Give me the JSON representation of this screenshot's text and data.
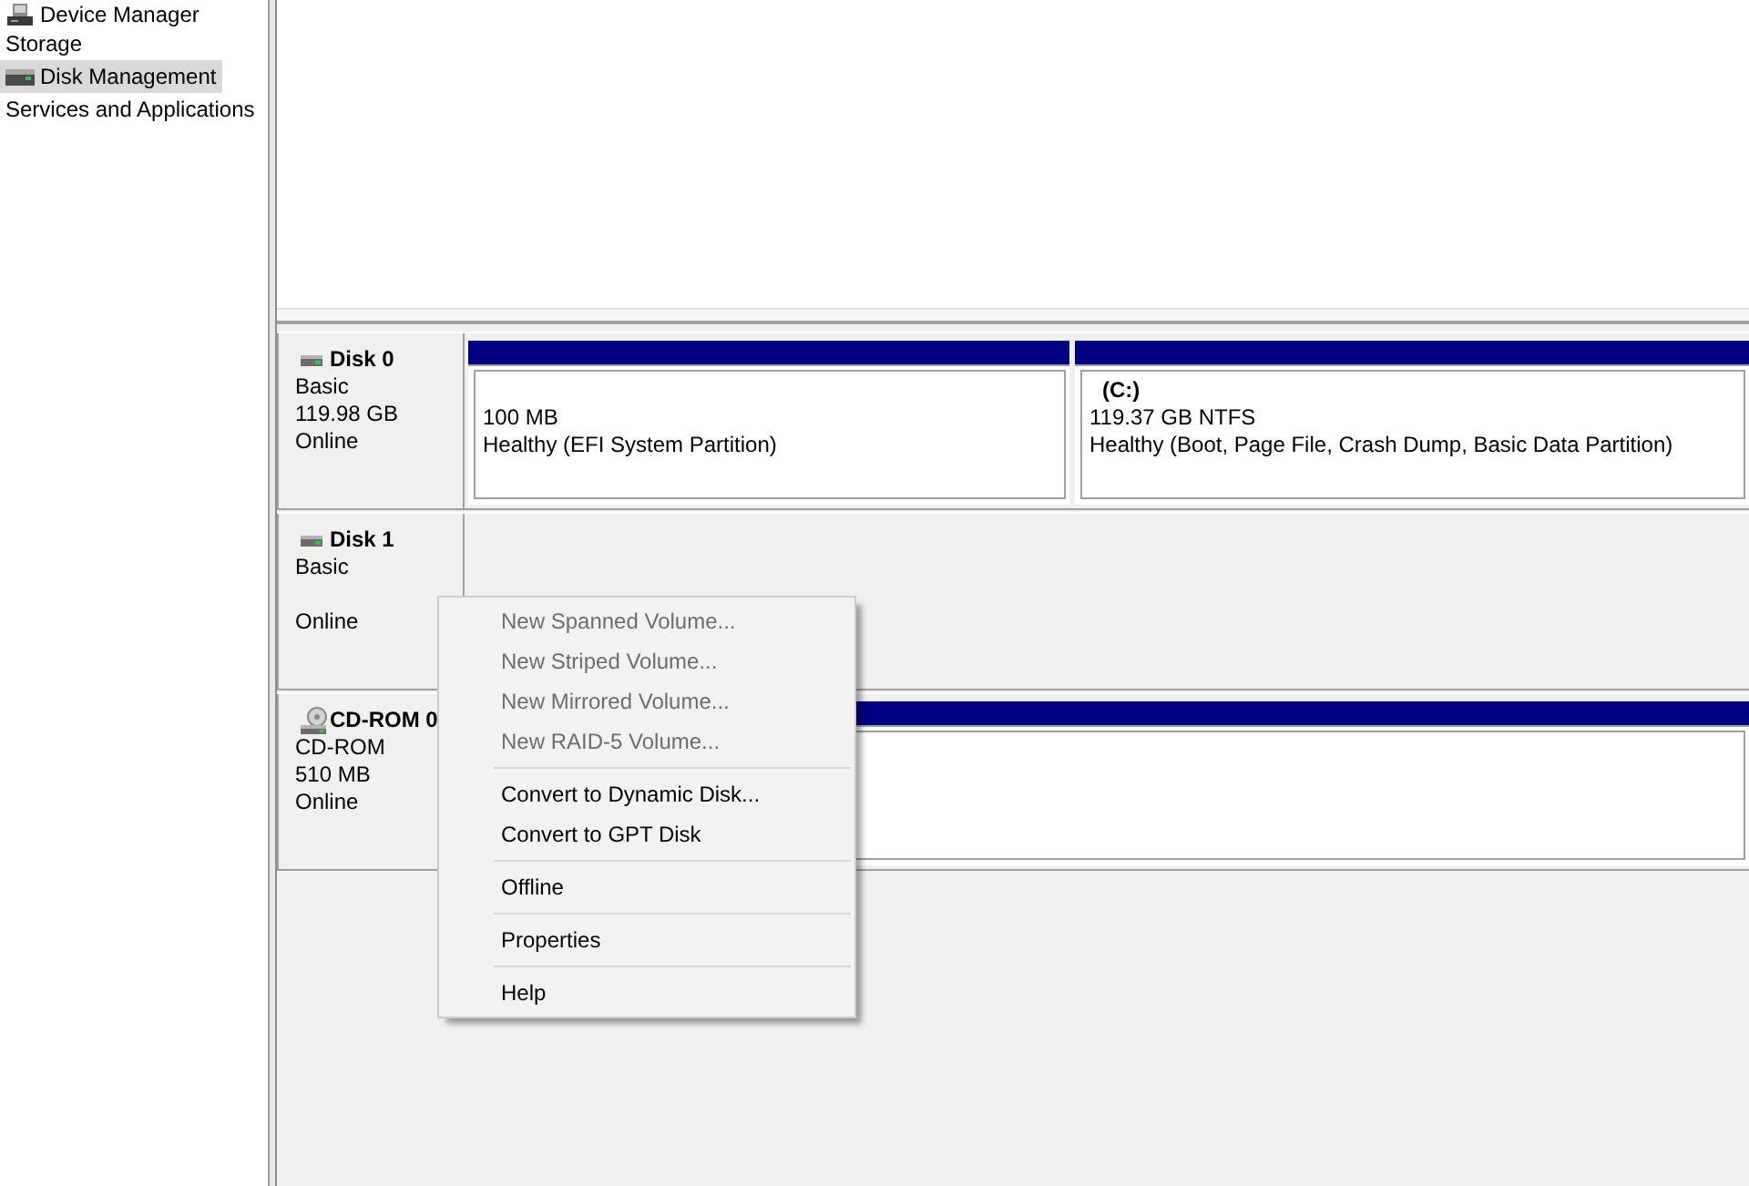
{
  "navigation": {
    "items": [
      {
        "label": "Device Manager",
        "kind": "device",
        "selected": false
      },
      {
        "label": "Storage",
        "kind": "category",
        "selected": false
      },
      {
        "label": "Disk Management",
        "kind": "disk",
        "selected": true
      },
      {
        "label": "Services and Applications",
        "kind": "category",
        "selected": false
      }
    ]
  },
  "disks": [
    {
      "kind": "disk",
      "name": "Disk 0",
      "type": "Basic",
      "size": "119.98 GB",
      "status": "Online",
      "partitions": [
        {
          "kind": "primary",
          "size": "100 MB",
          "status": "Healthy (EFI System Partition)"
        },
        {
          "kind": "primary",
          "name": "(C:)",
          "size": "119.37 GB NTFS",
          "status": "Healthy (Boot, Page File, Crash Dump, Basic Data Partition)"
        }
      ]
    },
    {
      "kind": "disk",
      "name": "Disk 1",
      "type": "Basic",
      "status": "Online"
    },
    {
      "kind": "cdrom",
      "name": "CD-ROM 0",
      "type": "CD-ROM",
      "size": "510 MB",
      "status": "Online",
      "partitions": [
        {
          "kind": "primary"
        }
      ]
    }
  ],
  "context_menu": {
    "items": [
      {
        "kind": "item",
        "label": "New Spanned Volume...",
        "disabled": true
      },
      {
        "kind": "item",
        "label": "New Striped Volume...",
        "disabled": true
      },
      {
        "kind": "item",
        "label": "New Mirrored Volume...",
        "disabled": true
      },
      {
        "kind": "item",
        "label": "New RAID-5 Volume...",
        "disabled": true
      },
      {
        "kind": "separator"
      },
      {
        "kind": "item",
        "label": "Convert to Dynamic Disk...",
        "disabled": false
      },
      {
        "kind": "item",
        "label": "Convert to GPT Disk",
        "disabled": false
      },
      {
        "kind": "separator"
      },
      {
        "kind": "item",
        "label": "Offline",
        "disabled": false
      },
      {
        "kind": "separator"
      },
      {
        "kind": "item",
        "label": "Properties",
        "disabled": false
      },
      {
        "kind": "separator"
      },
      {
        "kind": "item",
        "label": "Help",
        "disabled": false
      }
    ]
  }
}
